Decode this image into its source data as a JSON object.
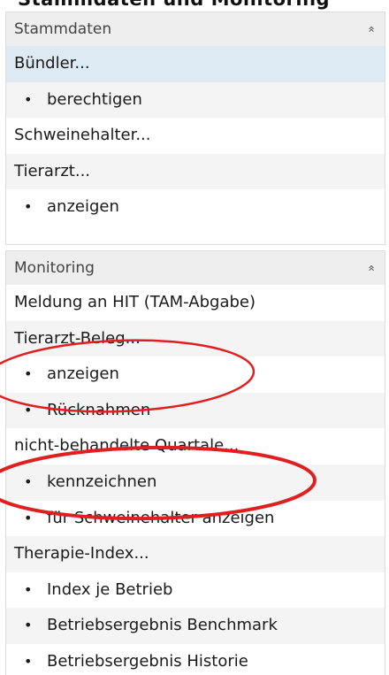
{
  "header_strip": {
    "text": "Stammdaten und Monitoring"
  },
  "panels": [
    {
      "title": "Stammdaten",
      "collapse_icon": "double-chevron-up-icon",
      "items": [
        {
          "label": "Bündler...",
          "type": "group",
          "selected": true
        },
        {
          "label": "berechtigen",
          "type": "action"
        },
        {
          "label": "Schweinehalter...",
          "type": "group"
        },
        {
          "label": "Tierarzt...",
          "type": "group"
        },
        {
          "label": "anzeigen",
          "type": "action"
        }
      ]
    },
    {
      "title": "Monitoring",
      "collapse_icon": "double-chevron-up-icon",
      "items": [
        {
          "label": "Meldung an HIT (TAM-Abgabe)",
          "type": "group"
        },
        {
          "label": "Tierarzt-Beleg...",
          "type": "group"
        },
        {
          "label": "anzeigen",
          "type": "action"
        },
        {
          "label": "Rücknahmen",
          "type": "action"
        },
        {
          "label": "nicht-behandelte Quartale...",
          "type": "group"
        },
        {
          "label": "kennzeichnen",
          "type": "action"
        },
        {
          "label": "für Schweinehalter anzeigen",
          "type": "action"
        },
        {
          "label": "Therapie-Index...",
          "type": "group"
        },
        {
          "label": "Index je Betrieb",
          "type": "action"
        },
        {
          "label": "Betriebsergebnis Benchmark",
          "type": "action"
        },
        {
          "label": "Betriebsergebnis Historie",
          "type": "action"
        }
      ]
    }
  ],
  "bullet_glyph": "•",
  "collapse_glyph": "»",
  "colors": {
    "header_bg": "#eeeeee",
    "selected_bg": "#dde9f3",
    "alt_row_bg": "#f4f4f4",
    "annotation_red": "#e02020"
  },
  "annotations": [
    {
      "kind": "ellipse",
      "color": "#e02020",
      "encloses": "Tierarzt-Beleg... / anzeigen"
    },
    {
      "kind": "ellipse",
      "color": "#e02020",
      "encloses": "nicht-behandelte Quartale... / kennzeichnen"
    }
  ]
}
